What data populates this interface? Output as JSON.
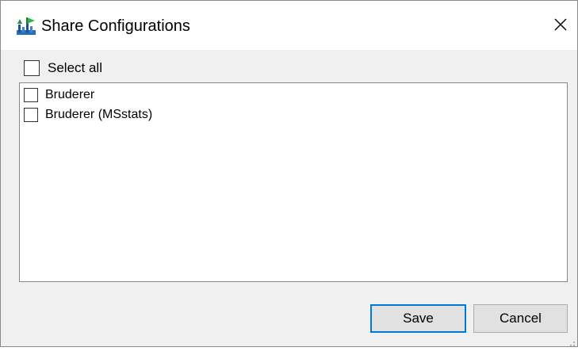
{
  "window": {
    "title": "Share Configurations",
    "icon": "skyline-app-icon"
  },
  "select_all": {
    "label": "Select all",
    "checked": false
  },
  "configurations": [
    {
      "label": "Bruderer",
      "checked": false
    },
    {
      "label": "Bruderer (MSstats)",
      "checked": false
    }
  ],
  "buttons": {
    "save_label": "Save",
    "cancel_label": "Cancel"
  },
  "colors": {
    "dialog_bg": "#f0f0f0",
    "focus_border": "#0078d7",
    "button_bg": "#e1e1e1"
  }
}
